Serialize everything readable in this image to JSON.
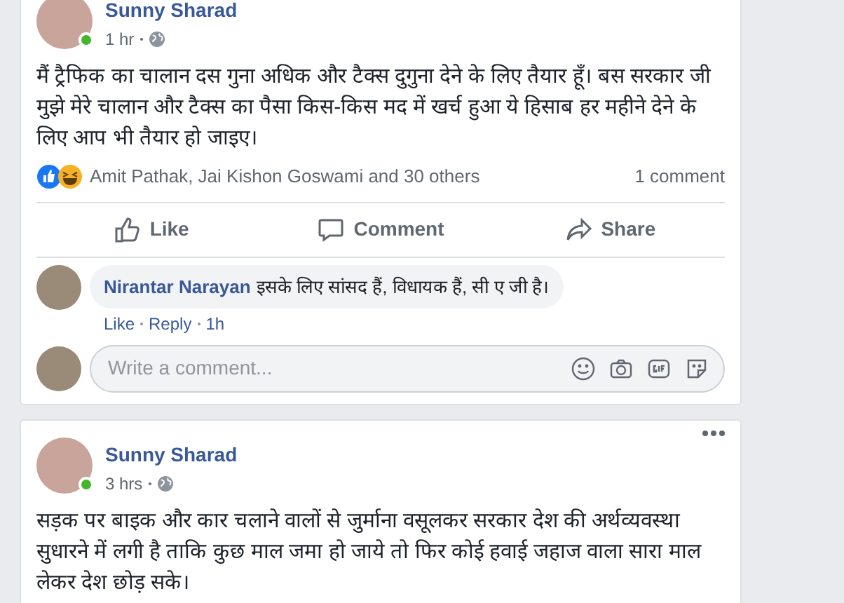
{
  "posts": [
    {
      "author": "Sunny Sharad",
      "online": true,
      "time": "1 hr",
      "text": "मैं ट्रैफिक का चालान दस गुना अधिक और टैक्स दुगुना देने के लिए तैयार हूँ। बस सरकार जी मुझे मेरे चालान और टैक्स का पैसा किस-किस मद में खर्च हुआ ये हिसाब हर महीने देने के लिए आप भी तैयार हो जाइए।",
      "reactions": "Amit Pathak, Jai Kishon Goswami and 30 others",
      "comment_count": "1 comment",
      "actions": [
        {
          "kind": "like",
          "label": "Like"
        },
        {
          "kind": "comment",
          "label": "Comment"
        },
        {
          "kind": "share",
          "label": "Share"
        }
      ],
      "comments": [
        {
          "author": "Nirantar Narayan",
          "text": "इसके लिए सांसद हैं, विधायक हैं, सी ए जी है।",
          "links": [
            "Like",
            "Reply"
          ],
          "time": "1h"
        }
      ],
      "composer": {
        "placeholder": "Write a comment..."
      }
    },
    {
      "author": "Sunny Sharad",
      "online": true,
      "time": "3 hrs",
      "text": "सड़क पर बाइक और कार चलाने वालों से जुर्माना वसूलकर सरकार देश की अर्थव्यवस्था सुधारने में लगी है ताकि कुछ माल जमा हो जाये तो फिर कोई हवाई जहाज वाला सारा माल लेकर देश छोड़ सके।"
    }
  ]
}
